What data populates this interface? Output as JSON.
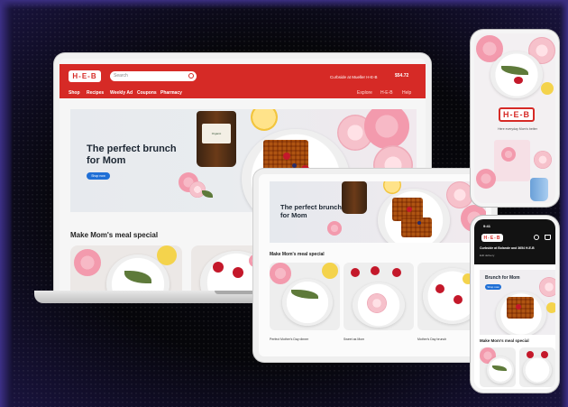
{
  "brand": {
    "logo_text": "H‑E‑B",
    "primary_color": "#d62a26",
    "button_color": "#1f6fd6"
  },
  "laptop": {
    "search_placeholder": "Search",
    "store_text": "Curbside at Mueller H-E-B",
    "cart_total": "$54.72",
    "nav": [
      "Shop",
      "Recipes",
      "Weekly Ad",
      "Coupons",
      "Pharmacy"
    ],
    "nav_right": [
      "Explore",
      "H-E-B",
      "Help"
    ],
    "hero_title": "The perfect brunch for Mom",
    "hero_button": "Shop now",
    "section_title": "Make Mom's meal special",
    "jar_label": "Organic"
  },
  "tablet": {
    "hero_title": "The perfect brunch for Mom",
    "section_title": "Make Mom's meal special",
    "captions": [
      "Perfect Mother's Day dinner",
      "Sweet as Mom",
      "Mother's Day brunch"
    ]
  },
  "phone_top": {
    "logo_text": "H‑E‑B",
    "tagline": "Here everyday Mom's better"
  },
  "phone_bottom": {
    "time": "9:41",
    "logo_text": "H‑E‑B",
    "address": "Curbside at Bolande and 3654 H-E-B",
    "address_sub": "Edit delivery",
    "hero_title": "Brunch for Mom",
    "hero_button": "Shop now",
    "section_title": "Make Mom's meal special"
  }
}
